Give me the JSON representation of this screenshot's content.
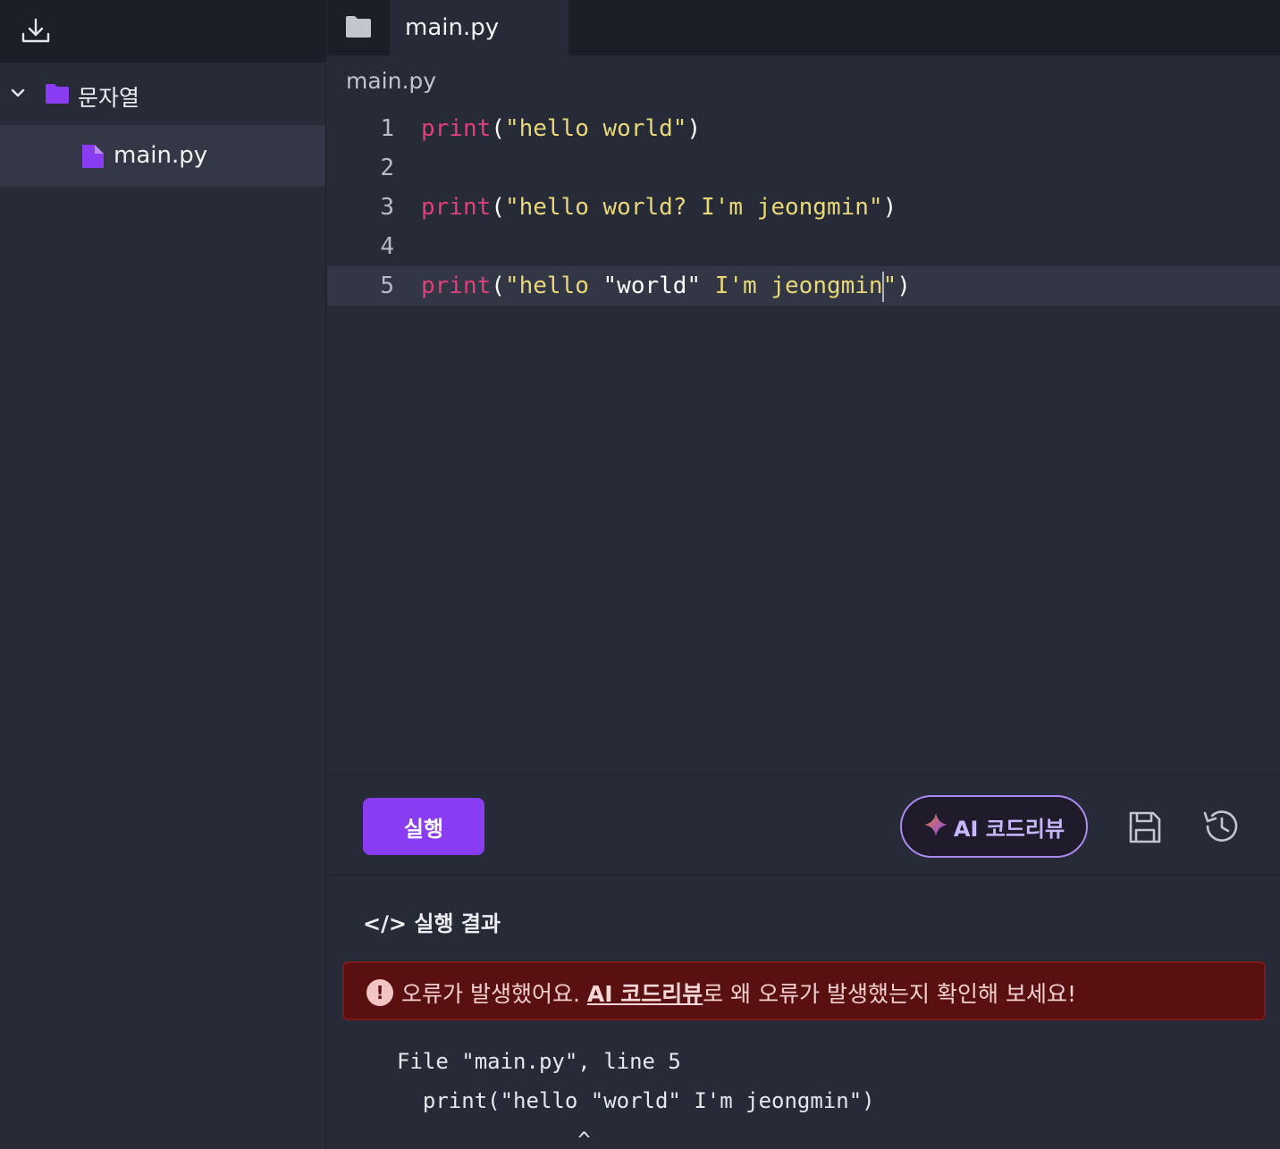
{
  "sidebar": {
    "download_icon": "download-icon",
    "folder": {
      "name": "문자열",
      "icon": "folder-icon",
      "expanded": true
    },
    "files": [
      {
        "name": "main.py",
        "icon": "file-icon",
        "selected": true
      }
    ]
  },
  "tabs": {
    "folder_icon": "folder-icon",
    "items": [
      {
        "label": "main.py",
        "active": true
      }
    ]
  },
  "editor": {
    "file_path": "main.py",
    "lines": [
      {
        "n": "1",
        "fn": "print",
        "open": "(",
        "str": "\"hello world\"",
        "close": ")"
      },
      {
        "n": "2"
      },
      {
        "n": "3",
        "fn": "print",
        "open": "(",
        "str": "\"hello world? I'm jeongmin\"",
        "close": ")"
      },
      {
        "n": "4"
      },
      {
        "n": "5",
        "fn": "print",
        "open": "(",
        "str_a": "\"hello ",
        "plain": "\"world\"",
        "str_b": " I'm jeongmin",
        "str_c": "\"",
        "close": ")",
        "active": true
      }
    ]
  },
  "actions": {
    "run_label": "실행",
    "ai_review_label": "AI 코드리뷰",
    "save_icon": "save-icon",
    "history_icon": "history-icon"
  },
  "result": {
    "title": "</> 실행 결과",
    "error_prefix": "오류가 발생했어요. ",
    "error_link": "AI 코드리뷰",
    "error_suffix": "로 왜 오류가 발생했는지 확인해 보세요!",
    "trace_lines": [
      "File \"main.py\", line 5",
      "  print(\"hello \"world\" I'm jeongmin\")",
      "              ^"
    ]
  },
  "colors": {
    "accent": "#8a3cf2",
    "keyword": "#e0407a",
    "string": "#e8d87a",
    "error_bg": "#5a1010"
  }
}
